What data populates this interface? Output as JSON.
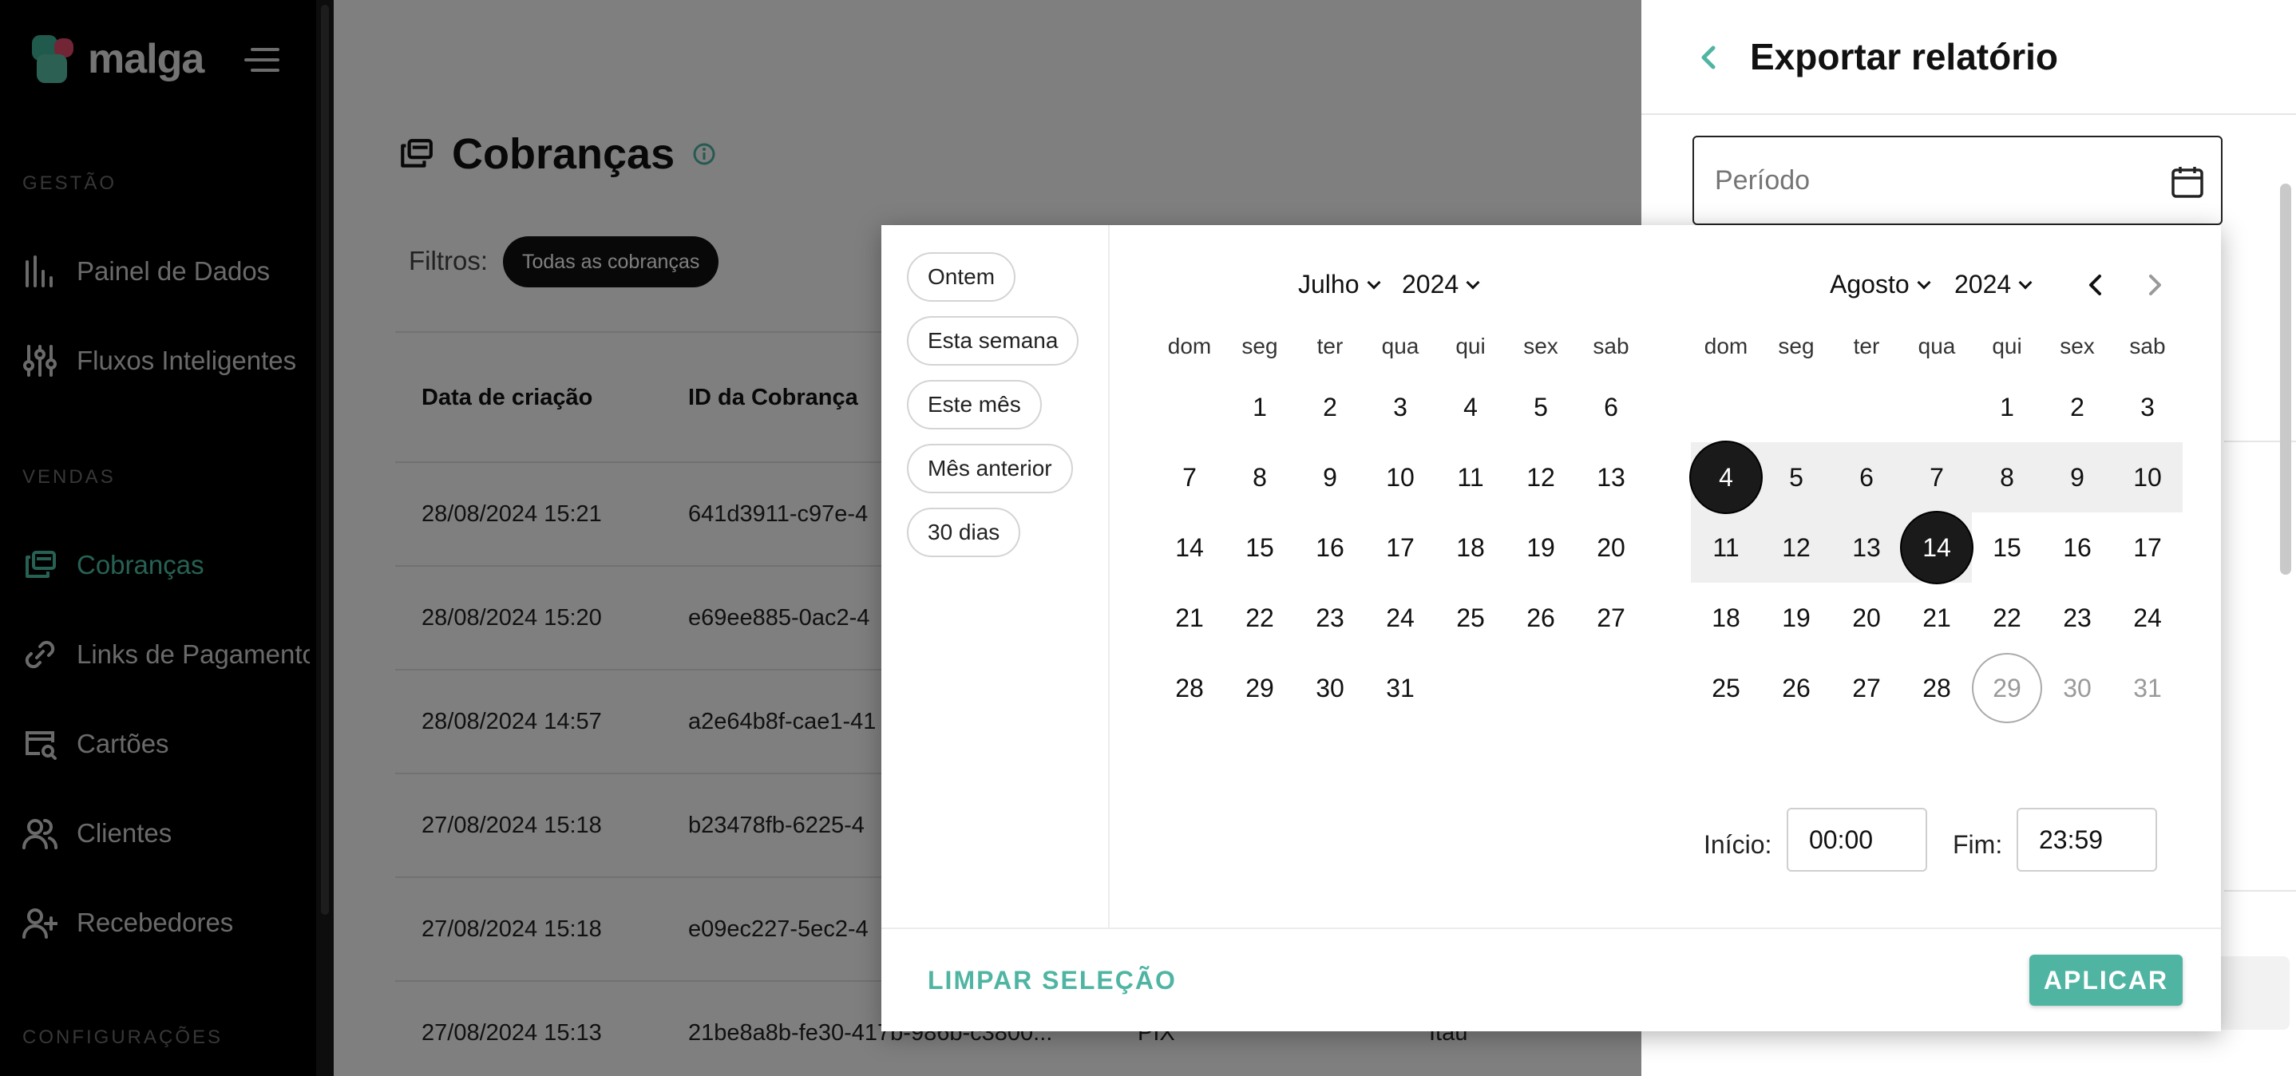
{
  "sidebar": {
    "brand": "malga",
    "sections": [
      "GESTÃO",
      "VENDAS",
      "CONFIGURAÇÕES"
    ],
    "items": [
      {
        "label": "Painel de Dados",
        "icon": "bar-chart-icon"
      },
      {
        "label": "Fluxos Inteligentes",
        "icon": "sliders-icon"
      },
      {
        "label": "Cobranças",
        "icon": "charges-icon",
        "active": true
      },
      {
        "label": "Links de Pagamento",
        "icon": "link-icon"
      },
      {
        "label": "Cartões",
        "icon": "card-search-icon"
      },
      {
        "label": "Clientes",
        "icon": "users-icon"
      },
      {
        "label": "Recebedores",
        "icon": "user-plus-icon"
      }
    ]
  },
  "main": {
    "title": "Cobranças",
    "filters_label": "Filtros:",
    "filter_chip": "Todas as cobranças",
    "columns": [
      "Data de criação",
      "ID da Cobrança"
    ],
    "rows": [
      {
        "date": "28/08/2024 15:21",
        "id": "641d3911-c97e-4"
      },
      {
        "date": "28/08/2024 15:20",
        "id": "e69ee885-0ac2-4"
      },
      {
        "date": "28/08/2024 14:57",
        "id": "a2e64b8f-cae1-41"
      },
      {
        "date": "27/08/2024 15:18",
        "id": "b23478fb-6225-4"
      },
      {
        "date": "27/08/2024 15:18",
        "id": "e09ec227-5ec2-4"
      },
      {
        "date": "27/08/2024 15:13",
        "id": "21be8a8b-fe30-417b-986b-c3800...",
        "method": "PIX",
        "bank": "Itaú"
      }
    ]
  },
  "drawer": {
    "title": "Exportar relatório",
    "period_placeholder": "Período"
  },
  "picker": {
    "presets": [
      "Ontem",
      "Esta semana",
      "Este mês",
      "Mês anterior",
      "30 dias"
    ],
    "weekdays": [
      "dom",
      "seg",
      "ter",
      "qua",
      "qui",
      "sex",
      "sab"
    ],
    "left": {
      "month": "Julho",
      "year": "2024",
      "first_weekday": 1,
      "days": 31
    },
    "right": {
      "month": "Agosto",
      "year": "2024",
      "first_weekday": 4,
      "days": 31
    },
    "range": {
      "start": 4,
      "end": 14
    },
    "today": 29,
    "start_label": "Início:",
    "start_time": "00:00",
    "end_label": "Fim:",
    "end_time": "23:59",
    "clear_label": "LIMPAR SELEÇÃO",
    "apply_label": "APLICAR"
  },
  "colors": {
    "accent": "#4fb5a2",
    "sidebar_bg": "#000000"
  }
}
